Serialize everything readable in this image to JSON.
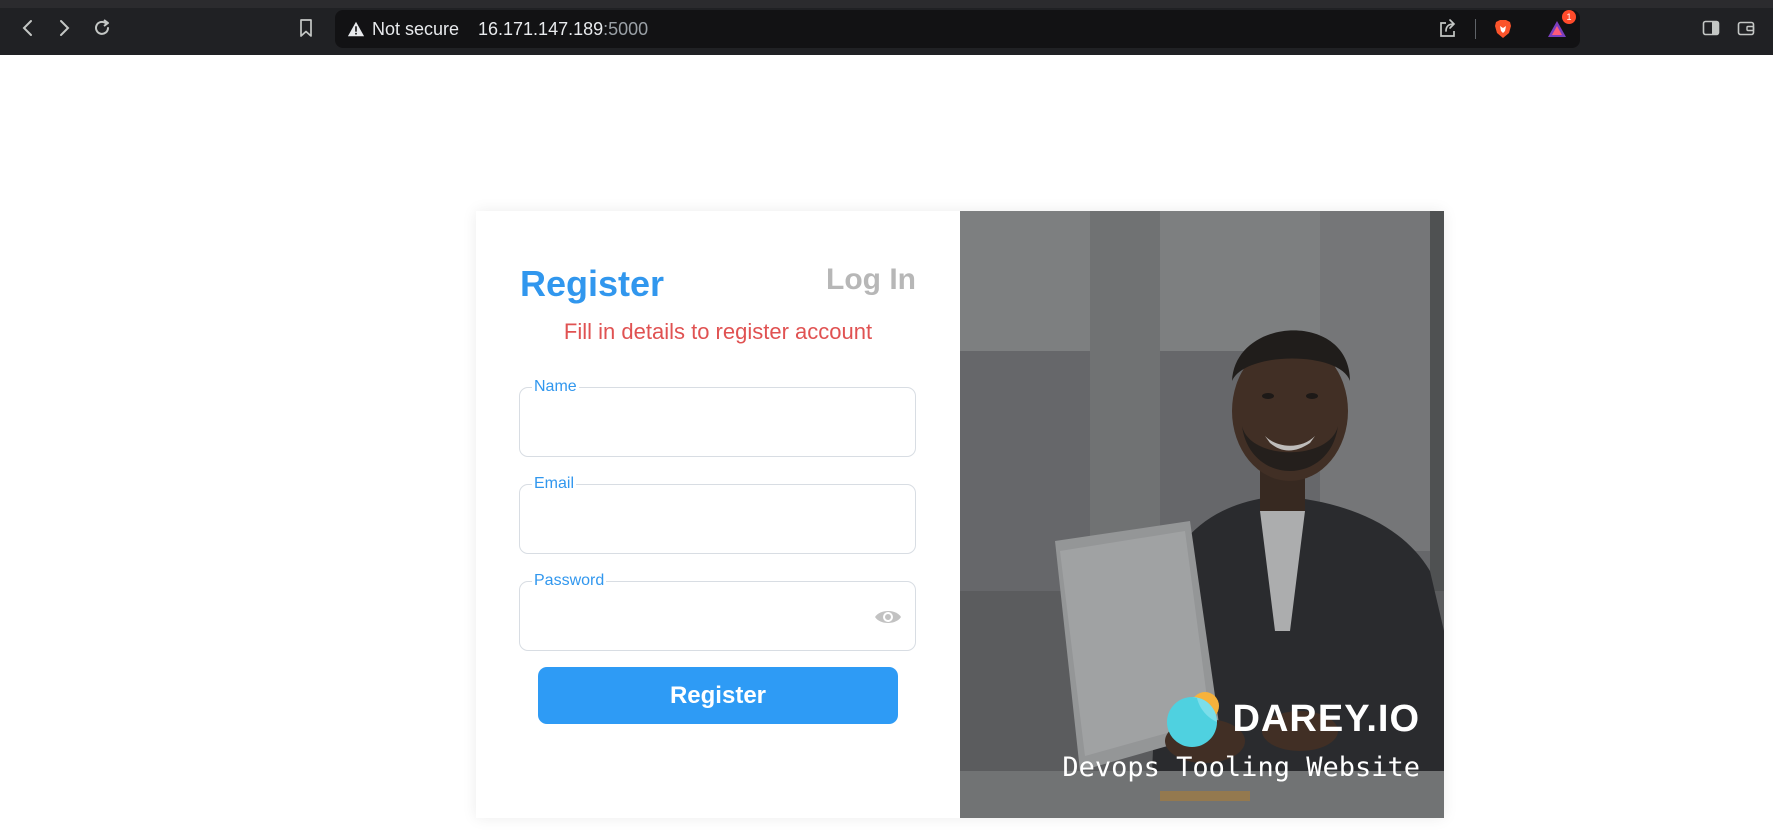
{
  "browser": {
    "security_label": "Not secure",
    "url_host": "16.171.147.189",
    "url_port": ":5000",
    "notification_count": "1"
  },
  "form": {
    "active_tab": "Register",
    "inactive_tab": "Log In",
    "subtitle": "Fill in details to register account",
    "fields": [
      {
        "label": "Name",
        "value": ""
      },
      {
        "label": "Email",
        "value": ""
      },
      {
        "label": "Password",
        "value": ""
      }
    ],
    "submit_label": "Register"
  },
  "hero": {
    "brand_name": "DAREY.IO",
    "tagline": "Devops Tooling Website"
  },
  "colors": {
    "accent": "#3197ee",
    "button": "#2e9bf5",
    "subtitle": "#e05252",
    "inactive_tab": "#b7b7b7"
  }
}
